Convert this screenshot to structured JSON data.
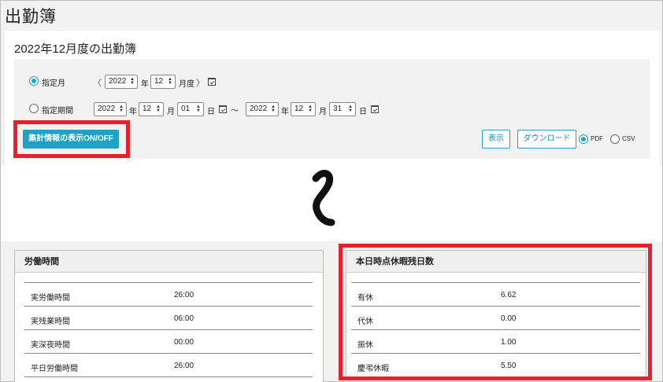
{
  "page": {
    "title": "出勤簿"
  },
  "card": {
    "title": "2022年12月度の出勤簿"
  },
  "filter": {
    "month_label": "指定月",
    "period_label": "指定期間",
    "month_year": "2022",
    "month_month": "12",
    "year_unit": "年",
    "month_unit_full": "月度",
    "month_unit": "月",
    "day_unit": "日",
    "tilde": "～",
    "period_start": {
      "year": "2022",
      "month": "12",
      "day": "01"
    },
    "period_end": {
      "year": "2022",
      "month": "12",
      "day": "31"
    },
    "prev_chevron": "〈",
    "next_chevron": "〉"
  },
  "actions": {
    "aggregate_toggle": "集計情報の表示ON/OFF",
    "show": "表示",
    "download": "ダウンロード",
    "pdf": "PDF",
    "csv": "CSV"
  },
  "work_time": {
    "title": "労働時間",
    "rows": [
      {
        "label": "実労働時間",
        "value": "26:00"
      },
      {
        "label": "実残業時間",
        "value": "06:00"
      },
      {
        "label": "実深夜時間",
        "value": "00:00"
      },
      {
        "label": "平日労働時間",
        "value": "26:00"
      }
    ]
  },
  "leave": {
    "title": "本日時点休暇残日数",
    "rows": [
      {
        "label": "有休",
        "value": "6.62"
      },
      {
        "label": "代休",
        "value": "0.00"
      },
      {
        "label": "振休",
        "value": "1.00"
      },
      {
        "label": "慶弔休暇",
        "value": "5.50"
      }
    ]
  },
  "colors": {
    "accent": "#1fa3c2",
    "highlight": "#e8202a"
  }
}
